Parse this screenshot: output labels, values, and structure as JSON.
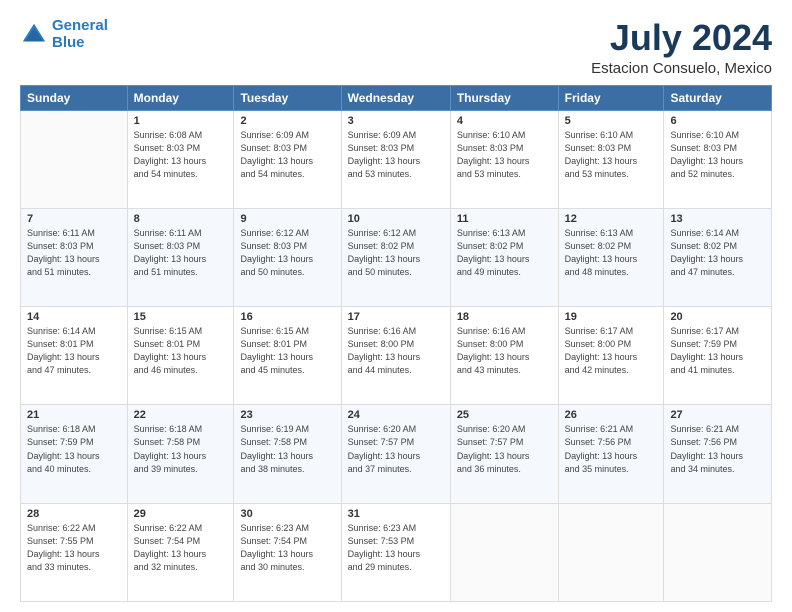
{
  "logo": {
    "line1": "General",
    "line2": "Blue"
  },
  "title": "July 2024",
  "location": "Estacion Consuelo, Mexico",
  "weekdays": [
    "Sunday",
    "Monday",
    "Tuesday",
    "Wednesday",
    "Thursday",
    "Friday",
    "Saturday"
  ],
  "weeks": [
    [
      {
        "day": "",
        "info": ""
      },
      {
        "day": "1",
        "info": "Sunrise: 6:08 AM\nSunset: 8:03 PM\nDaylight: 13 hours\nand 54 minutes."
      },
      {
        "day": "2",
        "info": "Sunrise: 6:09 AM\nSunset: 8:03 PM\nDaylight: 13 hours\nand 54 minutes."
      },
      {
        "day": "3",
        "info": "Sunrise: 6:09 AM\nSunset: 8:03 PM\nDaylight: 13 hours\nand 53 minutes."
      },
      {
        "day": "4",
        "info": "Sunrise: 6:10 AM\nSunset: 8:03 PM\nDaylight: 13 hours\nand 53 minutes."
      },
      {
        "day": "5",
        "info": "Sunrise: 6:10 AM\nSunset: 8:03 PM\nDaylight: 13 hours\nand 53 minutes."
      },
      {
        "day": "6",
        "info": "Sunrise: 6:10 AM\nSunset: 8:03 PM\nDaylight: 13 hours\nand 52 minutes."
      }
    ],
    [
      {
        "day": "7",
        "info": "Sunrise: 6:11 AM\nSunset: 8:03 PM\nDaylight: 13 hours\nand 51 minutes."
      },
      {
        "day": "8",
        "info": "Sunrise: 6:11 AM\nSunset: 8:03 PM\nDaylight: 13 hours\nand 51 minutes."
      },
      {
        "day": "9",
        "info": "Sunrise: 6:12 AM\nSunset: 8:03 PM\nDaylight: 13 hours\nand 50 minutes."
      },
      {
        "day": "10",
        "info": "Sunrise: 6:12 AM\nSunset: 8:02 PM\nDaylight: 13 hours\nand 50 minutes."
      },
      {
        "day": "11",
        "info": "Sunrise: 6:13 AM\nSunset: 8:02 PM\nDaylight: 13 hours\nand 49 minutes."
      },
      {
        "day": "12",
        "info": "Sunrise: 6:13 AM\nSunset: 8:02 PM\nDaylight: 13 hours\nand 48 minutes."
      },
      {
        "day": "13",
        "info": "Sunrise: 6:14 AM\nSunset: 8:02 PM\nDaylight: 13 hours\nand 47 minutes."
      }
    ],
    [
      {
        "day": "14",
        "info": "Sunrise: 6:14 AM\nSunset: 8:01 PM\nDaylight: 13 hours\nand 47 minutes."
      },
      {
        "day": "15",
        "info": "Sunrise: 6:15 AM\nSunset: 8:01 PM\nDaylight: 13 hours\nand 46 minutes."
      },
      {
        "day": "16",
        "info": "Sunrise: 6:15 AM\nSunset: 8:01 PM\nDaylight: 13 hours\nand 45 minutes."
      },
      {
        "day": "17",
        "info": "Sunrise: 6:16 AM\nSunset: 8:00 PM\nDaylight: 13 hours\nand 44 minutes."
      },
      {
        "day": "18",
        "info": "Sunrise: 6:16 AM\nSunset: 8:00 PM\nDaylight: 13 hours\nand 43 minutes."
      },
      {
        "day": "19",
        "info": "Sunrise: 6:17 AM\nSunset: 8:00 PM\nDaylight: 13 hours\nand 42 minutes."
      },
      {
        "day": "20",
        "info": "Sunrise: 6:17 AM\nSunset: 7:59 PM\nDaylight: 13 hours\nand 41 minutes."
      }
    ],
    [
      {
        "day": "21",
        "info": "Sunrise: 6:18 AM\nSunset: 7:59 PM\nDaylight: 13 hours\nand 40 minutes."
      },
      {
        "day": "22",
        "info": "Sunrise: 6:18 AM\nSunset: 7:58 PM\nDaylight: 13 hours\nand 39 minutes."
      },
      {
        "day": "23",
        "info": "Sunrise: 6:19 AM\nSunset: 7:58 PM\nDaylight: 13 hours\nand 38 minutes."
      },
      {
        "day": "24",
        "info": "Sunrise: 6:20 AM\nSunset: 7:57 PM\nDaylight: 13 hours\nand 37 minutes."
      },
      {
        "day": "25",
        "info": "Sunrise: 6:20 AM\nSunset: 7:57 PM\nDaylight: 13 hours\nand 36 minutes."
      },
      {
        "day": "26",
        "info": "Sunrise: 6:21 AM\nSunset: 7:56 PM\nDaylight: 13 hours\nand 35 minutes."
      },
      {
        "day": "27",
        "info": "Sunrise: 6:21 AM\nSunset: 7:56 PM\nDaylight: 13 hours\nand 34 minutes."
      }
    ],
    [
      {
        "day": "28",
        "info": "Sunrise: 6:22 AM\nSunset: 7:55 PM\nDaylight: 13 hours\nand 33 minutes."
      },
      {
        "day": "29",
        "info": "Sunrise: 6:22 AM\nSunset: 7:54 PM\nDaylight: 13 hours\nand 32 minutes."
      },
      {
        "day": "30",
        "info": "Sunrise: 6:23 AM\nSunset: 7:54 PM\nDaylight: 13 hours\nand 30 minutes."
      },
      {
        "day": "31",
        "info": "Sunrise: 6:23 AM\nSunset: 7:53 PM\nDaylight: 13 hours\nand 29 minutes."
      },
      {
        "day": "",
        "info": ""
      },
      {
        "day": "",
        "info": ""
      },
      {
        "day": "",
        "info": ""
      }
    ]
  ]
}
